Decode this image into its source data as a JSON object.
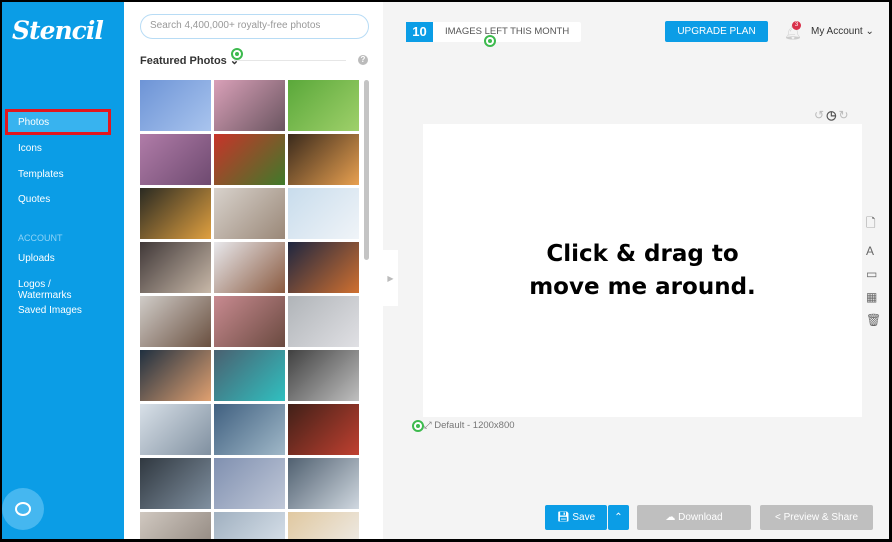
{
  "sidebar": {
    "logo": "Stencil",
    "items": [
      {
        "label": "Photos",
        "active": true
      },
      {
        "label": "Icons"
      },
      {
        "label": "Templates"
      },
      {
        "label": "Quotes"
      }
    ],
    "section": "ACCOUNT",
    "account_items": [
      {
        "label": "Uploads"
      },
      {
        "label": "Logos / Watermarks"
      },
      {
        "label": "Saved Images"
      }
    ]
  },
  "panel": {
    "search_placeholder": "Search 4,400,000+ royalty-free photos",
    "heading": "Featured Photos",
    "thumbnails": 27
  },
  "header": {
    "count": "10",
    "count_label": "IMAGES LEFT THIS MONTH",
    "upgrade": "UPGRADE PLAN",
    "notifications": "3",
    "account": "My Account"
  },
  "canvas": {
    "text_line1": "Click & drag to",
    "text_line2": "move me around.",
    "size": "Default - 1200x800"
  },
  "footer": {
    "save": "Save",
    "download": "Download",
    "share": "Preview & Share"
  },
  "colors": {
    "accent": "#0b9de6",
    "disabled": "#bfbfbf"
  }
}
